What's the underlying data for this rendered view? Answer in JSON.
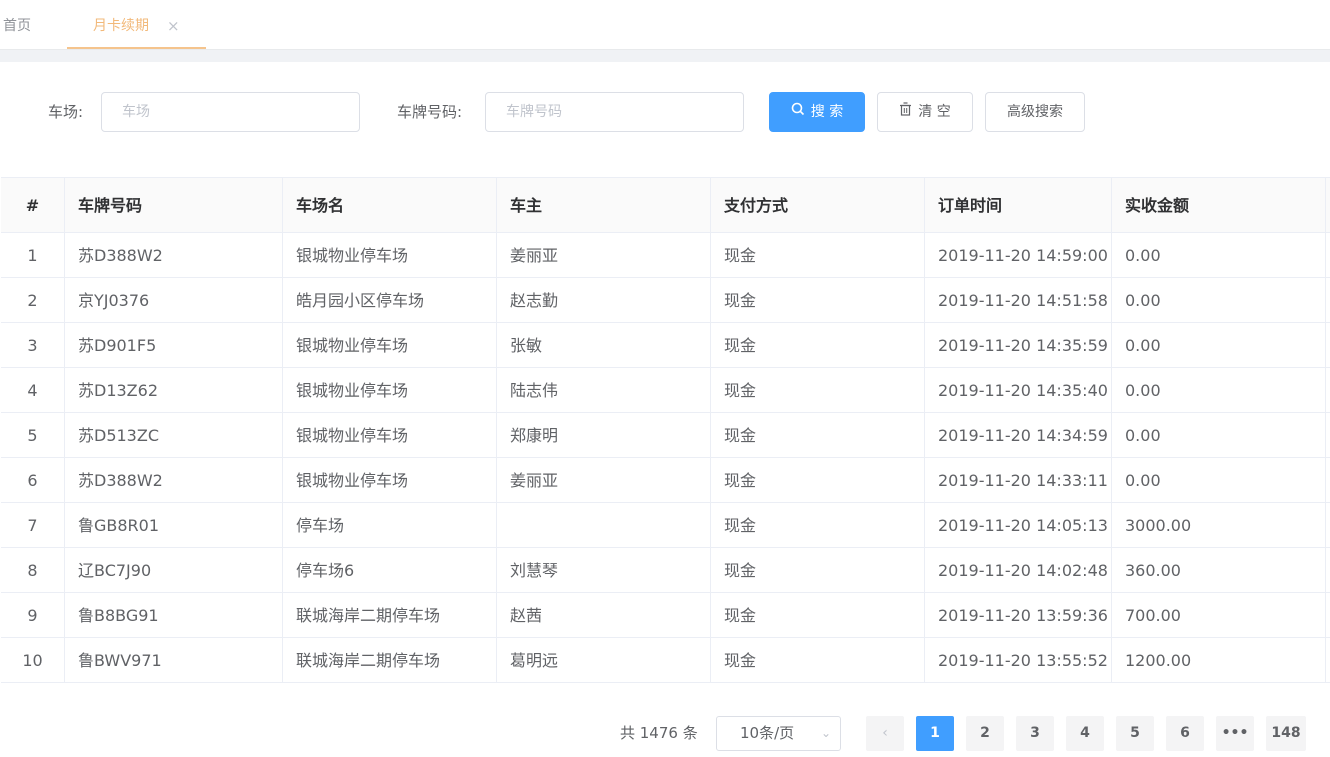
{
  "tabs": {
    "home_label": "首页",
    "active_label": "月卡续期",
    "close_glyph": "×"
  },
  "filter": {
    "lot_label": "车场:",
    "lot_placeholder": "车场",
    "plate_label": "车牌号码:",
    "plate_placeholder": "车牌号码",
    "search_label": "搜 索",
    "clear_label": "清 空",
    "advanced_label": "高级搜索"
  },
  "table": {
    "columns": [
      "#",
      "车牌号码",
      "车场名",
      "车主",
      "支付方式",
      "订单时间",
      "实收金额"
    ],
    "rows": [
      {
        "no": "1",
        "plate": "苏D388W2",
        "lot": "银城物业停车场",
        "owner": "姜丽亚",
        "pay": "现金",
        "time": "2019-11-20 14:59:00",
        "amount": "0.00"
      },
      {
        "no": "2",
        "plate": "京YJ0376",
        "lot": "皓月园小区停车场",
        "owner": "赵志勤",
        "pay": "现金",
        "time": "2019-11-20 14:51:58",
        "amount": "0.00"
      },
      {
        "no": "3",
        "plate": "苏D901F5",
        "lot": "银城物业停车场",
        "owner": "张敏",
        "pay": "现金",
        "time": "2019-11-20 14:35:59",
        "amount": "0.00"
      },
      {
        "no": "4",
        "plate": "苏D13Z62",
        "lot": "银城物业停车场",
        "owner": "陆志伟",
        "pay": "现金",
        "time": "2019-11-20 14:35:40",
        "amount": "0.00"
      },
      {
        "no": "5",
        "plate": "苏D513ZC",
        "lot": "银城物业停车场",
        "owner": "郑康明",
        "pay": "现金",
        "time": "2019-11-20 14:34:59",
        "amount": "0.00"
      },
      {
        "no": "6",
        "plate": "苏D388W2",
        "lot": "银城物业停车场",
        "owner": "姜丽亚",
        "pay": "现金",
        "time": "2019-11-20 14:33:11",
        "amount": "0.00"
      },
      {
        "no": "7",
        "plate": "鲁GB8R01",
        "lot": "停车场",
        "owner": "",
        "pay": "现金",
        "time": "2019-11-20 14:05:13",
        "amount": "3000.00"
      },
      {
        "no": "8",
        "plate": "辽BC7J90",
        "lot": "停车场6",
        "owner": "刘慧琴",
        "pay": "现金",
        "time": "2019-11-20 14:02:48",
        "amount": "360.00"
      },
      {
        "no": "9",
        "plate": "鲁B8BG91",
        "lot": "联城海岸二期停车场",
        "owner": "赵茜",
        "pay": "现金",
        "time": "2019-11-20 13:59:36",
        "amount": "700.00"
      },
      {
        "no": "10",
        "plate": "鲁BWV971",
        "lot": "联城海岸二期停车场",
        "owner": "葛明远",
        "pay": "现金",
        "time": "2019-11-20 13:55:52",
        "amount": "1200.00"
      }
    ]
  },
  "pagination": {
    "total_text": "共 1476 条",
    "page_size": "10条/页",
    "prev_glyph": "‹",
    "pages": [
      "1",
      "2",
      "3",
      "4",
      "5",
      "6",
      "•••",
      "148"
    ],
    "current": "1"
  },
  "colors": {
    "primary": "#409eff",
    "active_tab": "#f2b97a"
  }
}
